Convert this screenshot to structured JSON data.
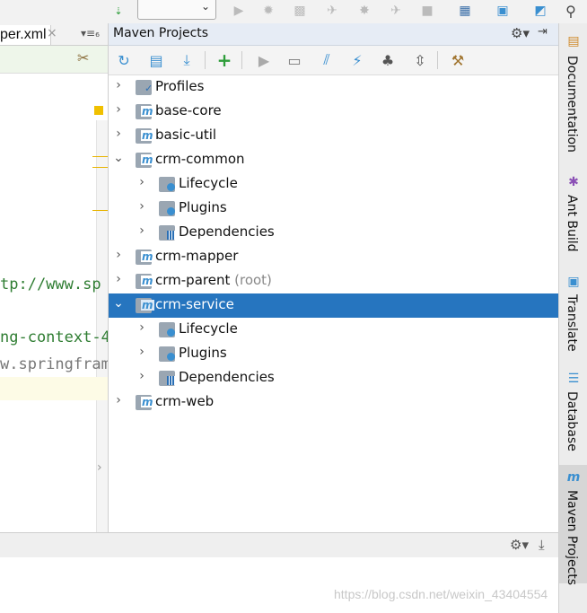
{
  "editor": {
    "tab_filename": "per.xml",
    "tab_close": "×",
    "tab_menu": "▾≡₆",
    "code_lines": [
      "tp://www.sp",
      "ng-context-4",
      "w.springfram"
    ]
  },
  "maven": {
    "title": "Maven Projects",
    "tree": [
      {
        "label": "Profiles",
        "level": 0,
        "arrow": "›",
        "icon": "profiles-icon"
      },
      {
        "label": "base-core",
        "level": 0,
        "arrow": "›",
        "icon": "maven-module-icon"
      },
      {
        "label": "basic-util",
        "level": 0,
        "arrow": "›",
        "icon": "maven-module-icon"
      },
      {
        "label": "crm-common",
        "level": 0,
        "arrow": "⌄",
        "icon": "maven-module-icon"
      },
      {
        "label": "Lifecycle",
        "level": 1,
        "arrow": "›",
        "icon": "lifecycle-icon"
      },
      {
        "label": "Plugins",
        "level": 1,
        "arrow": "›",
        "icon": "plugins-icon"
      },
      {
        "label": "Dependencies",
        "level": 1,
        "arrow": "›",
        "icon": "dependencies-icon"
      },
      {
        "label": "crm-mapper",
        "level": 0,
        "arrow": "›",
        "icon": "maven-module-icon"
      },
      {
        "label": "crm-parent",
        "suffix": "(root)",
        "level": 0,
        "arrow": "›",
        "icon": "maven-module-icon"
      },
      {
        "label": "crm-service",
        "level": 0,
        "arrow": "⌄",
        "icon": "maven-module-icon",
        "selected": true
      },
      {
        "label": "Lifecycle",
        "level": 1,
        "arrow": "›",
        "icon": "lifecycle-icon"
      },
      {
        "label": "Plugins",
        "level": 1,
        "arrow": "›",
        "icon": "plugins-icon"
      },
      {
        "label": "Dependencies",
        "level": 1,
        "arrow": "›",
        "icon": "dependencies-icon"
      },
      {
        "label": "crm-web",
        "level": 0,
        "arrow": "›",
        "icon": "maven-module-icon"
      }
    ]
  },
  "right_tabs": [
    "Documentation",
    "Ant Build",
    "Translate",
    "Database",
    "Maven Projects"
  ],
  "watermark": "https://blog.csdn.net/weixin_43404554",
  "colors": {
    "selection": "#2675bf",
    "header": "#e6ecf5",
    "accent_green": "#2e9d3a",
    "accent_blue": "#3a8fd0"
  }
}
